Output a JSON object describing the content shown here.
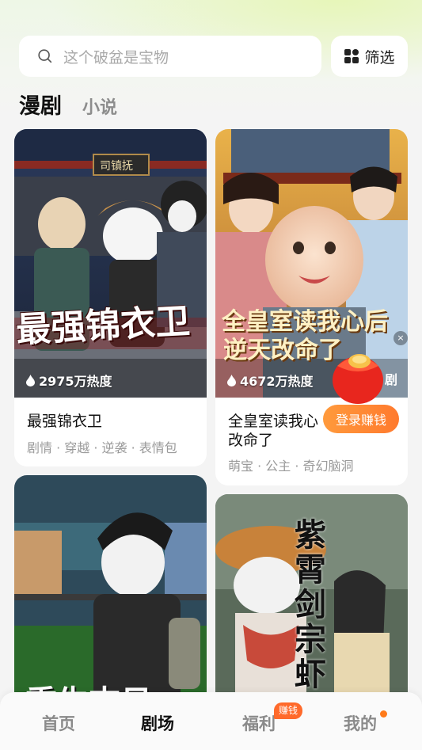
{
  "search": {
    "placeholder": "这个破盆是宝物"
  },
  "filter": {
    "label": "筛选"
  },
  "tabs": {
    "active": "漫剧",
    "other": "小说"
  },
  "cards": [
    {
      "title": "最强锦衣卫",
      "tags": "剧情 · 穿越 · 逆袭 · 表情包",
      "heat": "2975万热度",
      "cover_text": "最强锦衣卫",
      "sign_text": "司镇抚"
    },
    {
      "title": "全皇室读我心后逆天改命了",
      "title_line1": "全皇室读我心",
      "title_line2": "改命了",
      "tags": "萌宝 · 公主 · 奇幻脑洞",
      "heat": "4672万热度",
      "cover_text_1": "全皇室读我心后",
      "cover_text_2": "逆天改命了",
      "corner_tag": "剧"
    },
    {
      "cover_text": "重生末日"
    },
    {
      "cover_text": "紫霄剑宗虾"
    }
  ],
  "promo": {
    "login_label": "登录赚钱",
    "close": "×"
  },
  "nav": {
    "home": "首页",
    "theater": "剧场",
    "welfare": "福利",
    "welfare_badge": "赚钱",
    "mine": "我的"
  }
}
